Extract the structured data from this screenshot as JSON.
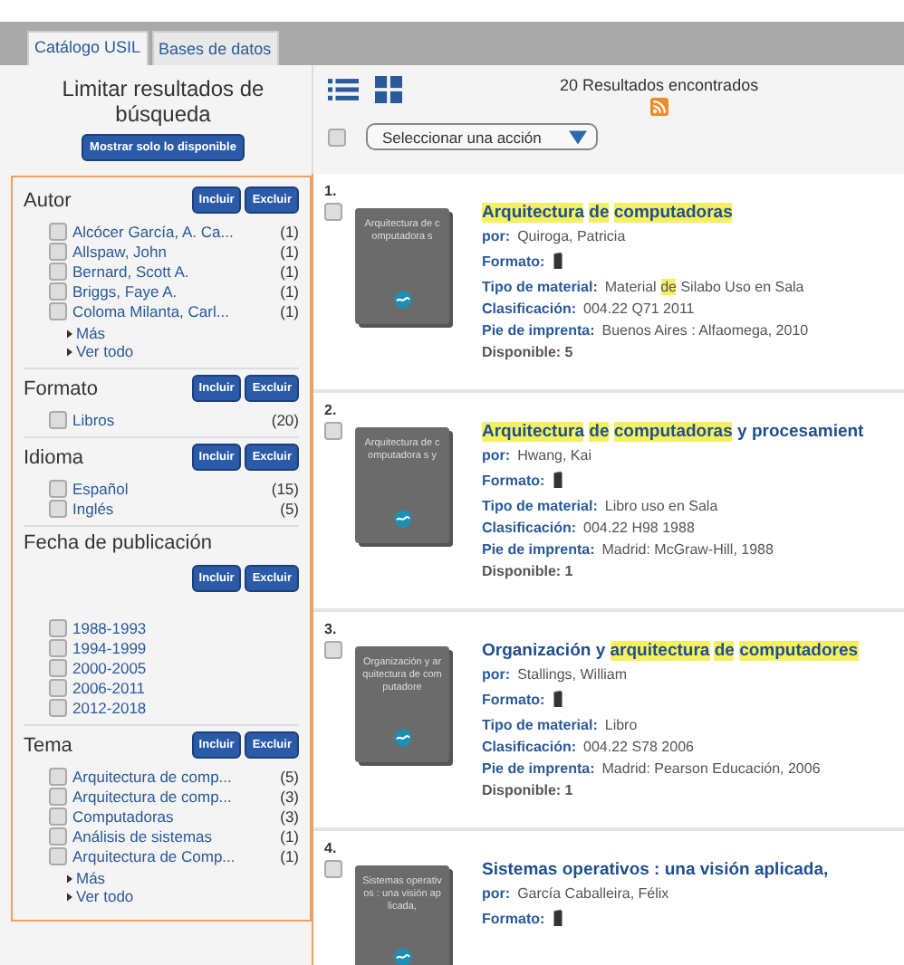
{
  "tabs": [
    {
      "label": "Catálogo USIL",
      "selected": true
    },
    {
      "label": "Bases de datos",
      "selected": false
    }
  ],
  "limit": {
    "title": "Limitar resultados de búsqueda",
    "button": "Mostrar solo lo disponible"
  },
  "facets": [
    {
      "title": "Autor",
      "buttons_below": false,
      "buttons": [
        "Incluir",
        "Excluir"
      ],
      "items": [
        {
          "label": "Alcócer García, A. Ca...",
          "count": "(1)",
          "checked": false
        },
        {
          "label": "Allspaw, John",
          "count": "(1)",
          "checked": false
        },
        {
          "label": "Bernard, Scott A.",
          "count": "(1)",
          "checked": false
        },
        {
          "label": "Briggs, Faye A.",
          "count": "(1)",
          "checked": false
        },
        {
          "label": "Coloma Milanta, Carl...",
          "count": "(1)",
          "checked": false
        }
      ],
      "links": [
        "Más",
        "Ver todo"
      ]
    },
    {
      "title": "Formato",
      "buttons_below": false,
      "buttons": [
        "Incluir",
        "Excluir"
      ],
      "items": [
        {
          "label": "Libros",
          "count": "(20)",
          "checked": false
        }
      ]
    },
    {
      "title": "Idioma",
      "buttons_below": false,
      "buttons": [
        "Incluir",
        "Excluir"
      ],
      "items": [
        {
          "label": "Español",
          "count": "(15)",
          "checked": false
        },
        {
          "label": "Inglés",
          "count": "(5)",
          "checked": false
        }
      ]
    },
    {
      "title": "Fecha de publicación",
      "buttons_below": true,
      "buttons": [
        "Incluir",
        "Excluir"
      ],
      "items": [
        {
          "label": "1988-1993",
          "checked": false
        },
        {
          "label": "1994-1999",
          "checked": false
        },
        {
          "label": "2000-2005",
          "checked": false
        },
        {
          "label": "2006-2011",
          "checked": false
        },
        {
          "label": "2012-2018",
          "checked": false
        }
      ]
    },
    {
      "title": "Tema",
      "buttons_below": false,
      "buttons": [
        "Incluir",
        "Excluir"
      ],
      "items": [
        {
          "label": "Arquitectura de comp...",
          "count": "(5)",
          "checked": false
        },
        {
          "label": "Arquitectura de comp...",
          "count": "(3)",
          "checked": false
        },
        {
          "label": "Computadoras",
          "count": "(3)",
          "checked": false
        },
        {
          "label": "Análisis de sistemas",
          "count": "(1)",
          "checked": false
        },
        {
          "label": "Arquitectura de Comp...",
          "count": "(1)",
          "checked": false
        }
      ],
      "links": [
        "Más",
        "Ver todo"
      ]
    }
  ],
  "results_header": {
    "count": "20 Resultados encontrados",
    "action_select": "Seleccionar una acción",
    "select_all_checked": false
  },
  "results": [
    {
      "number": "1.",
      "checked": false,
      "cover_text": "Arquitectura de computadora s",
      "title": [
        {
          "text": "Arquitectura",
          "highlight": true
        },
        {
          "text": "de",
          "highlight": true
        },
        {
          "text": "computadoras",
          "highlight": true
        }
      ],
      "author_label": "por:",
      "author": "Quiroga, Patricia",
      "format_label": "Formato:",
      "fields": [
        {
          "label": "Tipo de material:",
          "value": [
            {
              "text": "Material",
              "highlight": false
            },
            {
              "text": "de",
              "highlight": true
            },
            {
              "text": "Silabo Uso en Sala",
              "highlight": false
            }
          ]
        },
        {
          "label": "Clasificación:",
          "value": [
            {
              "text": "004.22 Q71 2011",
              "highlight": false
            }
          ]
        },
        {
          "label": "Pie de imprenta:",
          "value": [
            {
              "text": "Buenos Aires : Alfaomega, 2010",
              "highlight": false
            }
          ]
        }
      ],
      "availability": "Disponible: 5"
    },
    {
      "number": "2.",
      "checked": false,
      "cover_text": "Arquitectura de computadora s y",
      "title": [
        {
          "text": "Arquitectura",
          "highlight": true
        },
        {
          "text": "de",
          "highlight": true
        },
        {
          "text": "computadoras",
          "highlight": true
        },
        {
          "text": "y procesamient",
          "highlight": false
        }
      ],
      "author_label": "por:",
      "author": "Hwang, Kai",
      "format_label": "Formato:",
      "fields": [
        {
          "label": "Tipo de material:",
          "value": [
            {
              "text": "Libro uso en Sala",
              "highlight": false
            }
          ]
        },
        {
          "label": "Clasificación:",
          "value": [
            {
              "text": "004.22 H98 1988",
              "highlight": false
            }
          ]
        },
        {
          "label": "Pie de imprenta:",
          "value": [
            {
              "text": "Madrid: McGraw-Hill, 1988",
              "highlight": false
            }
          ]
        }
      ],
      "availability": "Disponible: 1"
    },
    {
      "number": "3.",
      "checked": false,
      "cover_text": "Organización y arquitectura de computadore",
      "title": [
        {
          "text": "Organización y",
          "highlight": false
        },
        {
          "text": "arquitectura",
          "highlight": true
        },
        {
          "text": "de",
          "highlight": true
        },
        {
          "text": "computadores",
          "highlight": true
        }
      ],
      "author_label": "por:",
      "author": "Stallings, William",
      "format_label": "Formato:",
      "fields": [
        {
          "label": "Tipo de material:",
          "value": [
            {
              "text": "Libro",
              "highlight": false
            }
          ]
        },
        {
          "label": "Clasificación:",
          "value": [
            {
              "text": "004.22 S78 2006",
              "highlight": false
            }
          ]
        },
        {
          "label": "Pie de imprenta:",
          "value": [
            {
              "text": "Madrid: Pearson Educación, 2006",
              "highlight": false
            }
          ]
        }
      ],
      "availability": "Disponible: 1"
    },
    {
      "number": "4.",
      "checked": false,
      "cover_text": "Sistemas operativos : una visión aplicada,",
      "title": [
        {
          "text": "Sistemas operativos : una visión aplicada,",
          "highlight": false
        }
      ],
      "author_label": "por:",
      "author": "García Caballeira, Félix",
      "format_label": "Formato:"
    }
  ]
}
